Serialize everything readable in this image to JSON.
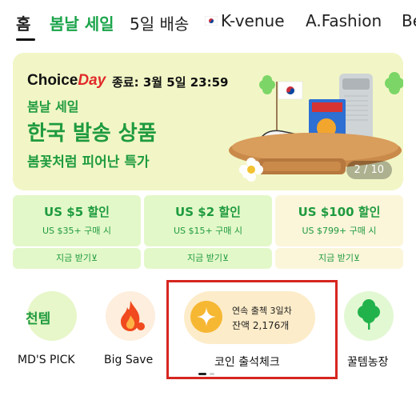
{
  "nav": {
    "tabs": [
      {
        "label": "홈"
      },
      {
        "label": "봄날 세일"
      },
      {
        "label": "5일 배송"
      },
      {
        "label": "K-venue",
        "icon": "korea-flag-icon"
      },
      {
        "label": "A.Fashion"
      },
      {
        "label": "Be"
      }
    ]
  },
  "banner": {
    "brand_choice": "Choice",
    "brand_day": "Day",
    "deadline": "종료: 3월 5일 23:59",
    "line1": "봄날 세일",
    "line2": "한국 발송 상품",
    "line3": "봄꽃처럼 피어난 특가",
    "pager": "2 / 10"
  },
  "coupons": [
    {
      "amount": "US $5 할인",
      "condition": "US $35+ 구매 시",
      "claim": "지금 받기⊻"
    },
    {
      "amount": "US $2 할인",
      "condition": "US $15+ 구매 시",
      "claim": "지금 받기⊻"
    },
    {
      "amount": "US $100 할인",
      "condition": "US $799+ 구매 시",
      "claim": "지금 받기⊻"
    }
  ],
  "shortcuts": {
    "mdspick": {
      "label": "MD'S PICK",
      "badge": "천템"
    },
    "bigsave": {
      "label": "Big Save"
    },
    "checkin": {
      "label": "코인 출석체크",
      "streak": "연속 출첵 3일차",
      "balance": "잔액 2,176개"
    },
    "farm": {
      "label": "꿀템농장"
    }
  },
  "colors": {
    "accent_green": "#1aa44a",
    "highlight_red": "#d6261f"
  }
}
